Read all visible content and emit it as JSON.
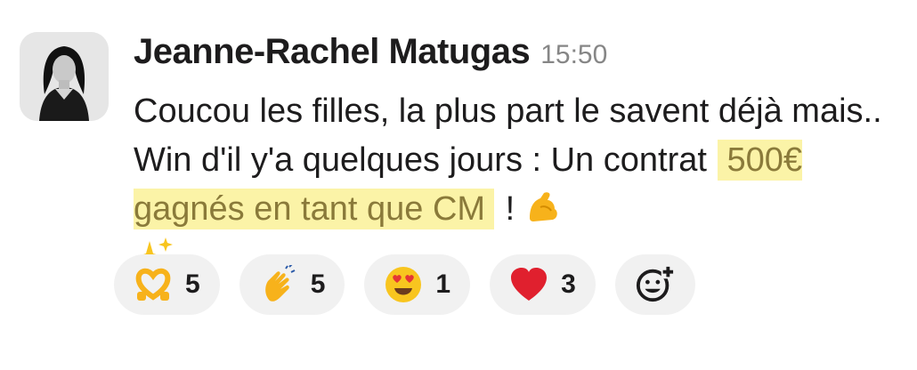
{
  "message": {
    "author": "Jeanne-Rachel Matugas",
    "time": "15:50",
    "text_before": "Coucou les filles, la plus part le savent déjà mais.. Win d'il y'a quelques jours : Un contrat ",
    "highlight": "500€ gagnés en tant que CM",
    "text_after": " ! ",
    "emojis": [
      "flexed-biceps",
      "sparkles"
    ]
  },
  "reactions": [
    {
      "icon": "heart-hands-icon",
      "count": "5"
    },
    {
      "icon": "clapping-hands-icon",
      "count": "5"
    },
    {
      "icon": "heart-eyes-icon",
      "count": "1"
    },
    {
      "icon": "red-heart-icon",
      "count": "3"
    }
  ],
  "add_reaction_icon": "add-reaction-icon",
  "colors": {
    "highlight_bg": "#fbf3a7",
    "highlight_text": "#8a7a3a",
    "reaction_bg": "#f1f1f1",
    "timestamp": "#868686"
  }
}
